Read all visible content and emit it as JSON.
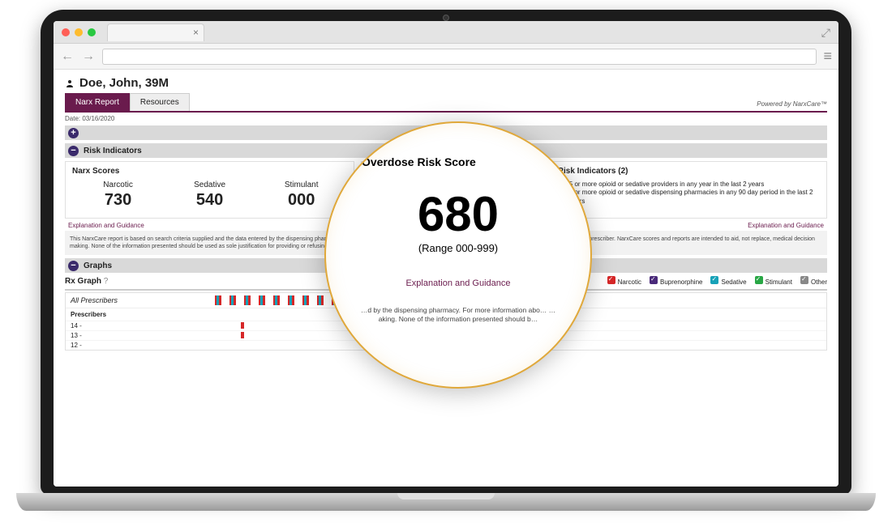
{
  "browser": {
    "tab_close": "×",
    "expand_icon": "⤢",
    "back_icon": "←",
    "forward_icon": "→",
    "menu_icon": "≡"
  },
  "patient": {
    "name_line": "Doe, John, 39M"
  },
  "tabs": {
    "narx": "Narx Report",
    "resources": "Resources"
  },
  "powered_by": "Powered by NarxCare™",
  "report_date": "Date: 03/16/2020",
  "sections": {
    "risk_indicators": "Risk Indicators",
    "graphs": "Graphs"
  },
  "scores_card": {
    "title": "Narx Scores",
    "cols": {
      "narcotic": {
        "label": "Narcotic",
        "value": "730"
      },
      "sedative": {
        "label": "Sedative",
        "value": "540"
      },
      "stimulant": {
        "label": "Stimulant",
        "value": "000"
      }
    }
  },
  "overdose_card": {
    "title": "Overdose Risk Score",
    "value": "680",
    "range": "(Range 000-999)"
  },
  "indicators_card": {
    "title": "Risk Indicators (2)",
    "items": [
      "5 or more opioid or sedative providers in any year in the last 2 years",
      "4 or more opioid or sedative dispensing pharmacies in any 90 day period in the last 2 years"
    ]
  },
  "guidance_link": "Explanation and Guidance",
  "disclaimer": "This NarxCare report is based on search criteria supplied and the data entered by the dispensing pharmacy. For more information about a specific prescription, please contact the dispensing pharmacy or the prescriber. NarxCare scores and reports are intended to aid, not replace, medical decision making. None of the information presented should be used as sole justification for providing or refusing to provide medications. The information on this report is not warranted as accurate or complete.",
  "rx_graph": {
    "title": "Rx Graph",
    "help": "?",
    "legend": {
      "narcotic": "Narcotic",
      "buprenorphine": "Buprenorphine",
      "sedative": "Sedative",
      "stimulant": "Stimulant",
      "other": "Other"
    },
    "all_prescribers": "All Prescribers",
    "prescribers_header": "Prescribers",
    "ids": [
      "14 -",
      "13 -",
      "12 -"
    ]
  },
  "magnifier": {
    "title": "Overdose Risk Score",
    "value": "680",
    "range": "(Range 000-999)",
    "guidance": "Explanation and Guidance",
    "disclaimer": "…d by the dispensing pharmacy. For more information abo…\n…aking. None of the information presented should b…"
  }
}
